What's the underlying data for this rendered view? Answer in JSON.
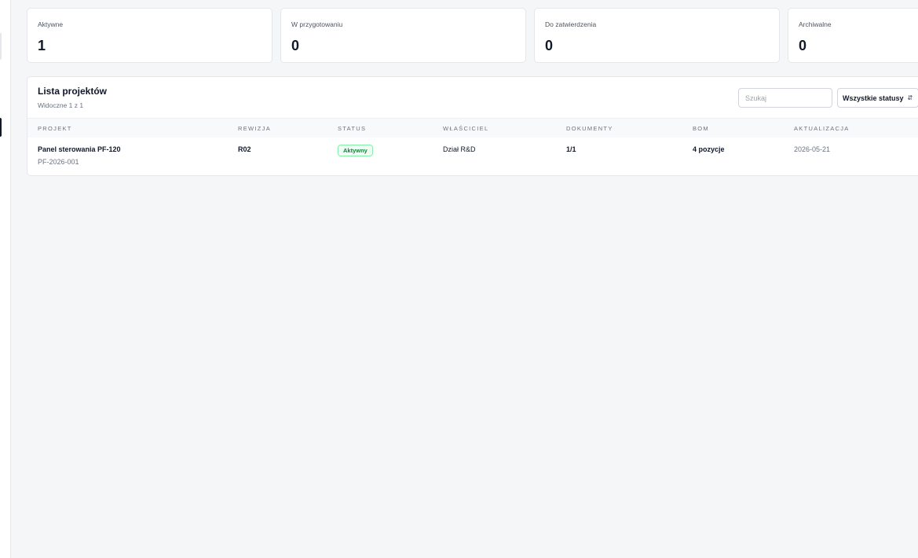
{
  "stats": [
    {
      "label": "Aktywne",
      "value": "1"
    },
    {
      "label": "W przygotowaniu",
      "value": "0"
    },
    {
      "label": "Do zatwierdzenia",
      "value": "0"
    },
    {
      "label": "Archiwalne",
      "value": "0"
    }
  ],
  "panel": {
    "title": "Lista projektów",
    "subtitle": "Widoczne 1 z 1",
    "search_placeholder": "Szukaj",
    "status_filter": "Wszystkie statusy"
  },
  "table": {
    "columns": [
      "Projekt",
      "Rewizja",
      "Status",
      "Właściciel",
      "Dokumenty",
      "BOM",
      "Aktualizacja"
    ],
    "rows": [
      {
        "name": "Panel sterowania PF-120",
        "code": "PF-2026-001",
        "revision": "R02",
        "status": "Aktywny",
        "owner": "Dział R&D",
        "documents": "1/1",
        "bom": "4 pozycje",
        "updated": "2026-05-21"
      }
    ]
  },
  "colors": {
    "background": "#f5f6f8",
    "status_active_text": "#15803d",
    "status_active_border": "#86efac"
  },
  "icons": {
    "select_chevrons": "chevrons-up-down-icon"
  }
}
